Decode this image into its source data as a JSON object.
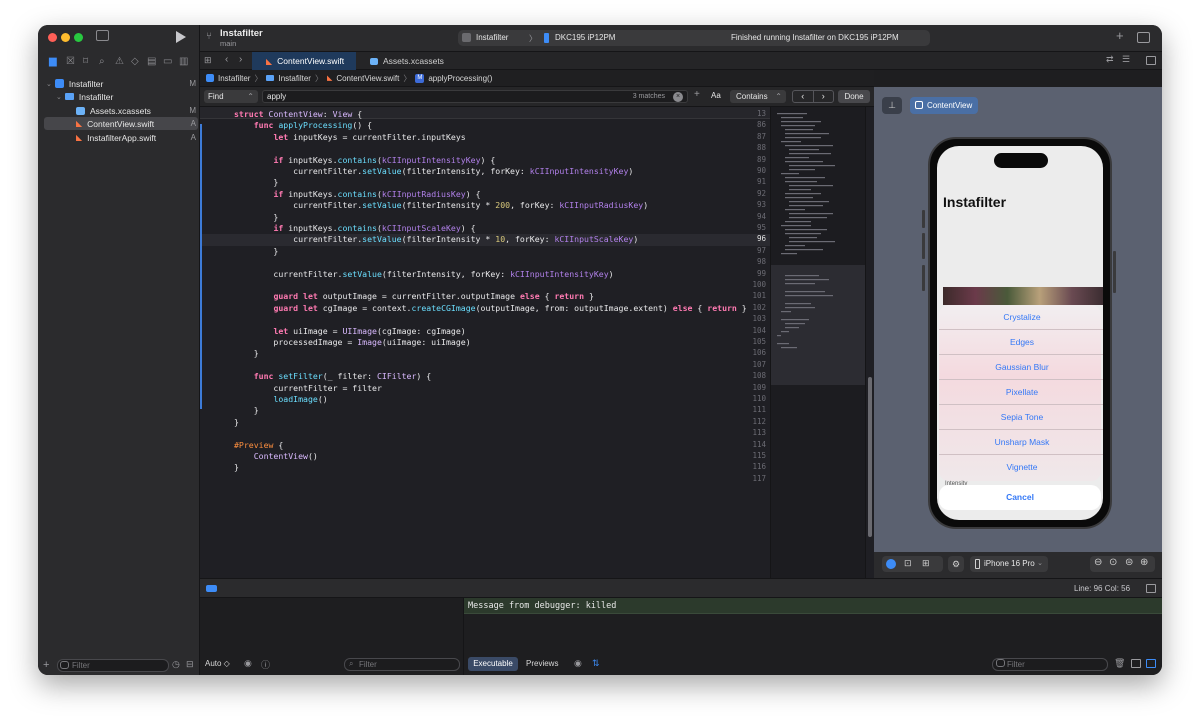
{
  "window": {
    "title": "Instafilter",
    "branch": "main"
  },
  "toolbar": {
    "scheme": "Instafilter",
    "scheme_chevron": "〉",
    "device": "DKC195 iP12PM",
    "status": "Finished running Instafilter on DKC195 iP12PM",
    "add_icon": "+"
  },
  "navigator": {
    "items": [
      {
        "label": "Instafilter",
        "badge": "M"
      },
      {
        "label": "Instafilter",
        "badge": ""
      },
      {
        "label": "Assets.xcassets",
        "badge": "M"
      },
      {
        "label": "ContentView.swift",
        "badge": "A"
      },
      {
        "label": "InstafilterApp.swift",
        "badge": "A"
      }
    ],
    "filter_placeholder": "Filter"
  },
  "tabs": [
    {
      "label": "ContentView.swift",
      "active": true
    },
    {
      "label": "Assets.xcassets",
      "active": false
    }
  ],
  "breadcrumbs": [
    "Instafilter",
    "Instafilter",
    "ContentView.swift",
    "applyProcessing()"
  ],
  "breadcrumb_sep": "〉",
  "find": {
    "mode": "Find",
    "query": "apply",
    "matches": "3 matches",
    "case_label": "Aa",
    "match_type": "Contains",
    "done_label": "Done"
  },
  "code_lines": [
    {
      "n": "13",
      "text": "struct ContentView: View {"
    },
    {
      "n": "86",
      "text": "    func applyProcessing() {"
    },
    {
      "n": "87",
      "text": "        let inputKeys = currentFilter.inputKeys"
    },
    {
      "n": "88",
      "text": ""
    },
    {
      "n": "89",
      "text": "        if inputKeys.contains(kCIInputIntensityKey) {"
    },
    {
      "n": "90",
      "text": "            currentFilter.setValue(filterIntensity, forKey: kCIInputIntensityKey)"
    },
    {
      "n": "91",
      "text": "        }"
    },
    {
      "n": "92",
      "text": "        if inputKeys.contains(kCIInputRadiusKey) {"
    },
    {
      "n": "93",
      "text": "            currentFilter.setValue(filterIntensity * 200, forKey: kCIInputRadiusKey)"
    },
    {
      "n": "94",
      "text": "        }"
    },
    {
      "n": "95",
      "text": "        if inputKeys.contains(kCIInputScaleKey) {"
    },
    {
      "n": "96",
      "text": "            currentFilter.setValue(filterIntensity * 10, forKey: kCIInputScaleKey)"
    },
    {
      "n": "97",
      "text": "        }"
    },
    {
      "n": "98",
      "text": ""
    },
    {
      "n": "99",
      "text": "        currentFilter.setValue(filterIntensity, forKey: kCIInputIntensityKey)"
    },
    {
      "n": "100",
      "text": ""
    },
    {
      "n": "101",
      "text": "        guard let outputImage = currentFilter.outputImage else { return }"
    },
    {
      "n": "102",
      "text": "        guard let cgImage = context.createCGImage(outputImage, from: outputImage.extent) else { return }"
    },
    {
      "n": "103",
      "text": ""
    },
    {
      "n": "104",
      "text": "        let uiImage = UIImage(cgImage: cgImage)"
    },
    {
      "n": "105",
      "text": "        processedImage = Image(uiImage: uiImage)"
    },
    {
      "n": "106",
      "text": "    }"
    },
    {
      "n": "107",
      "text": ""
    },
    {
      "n": "108",
      "text": "    func setFilter(_ filter: CIFilter) {"
    },
    {
      "n": "109",
      "text": "        currentFilter = filter"
    },
    {
      "n": "110",
      "text": "        loadImage()"
    },
    {
      "n": "111",
      "text": "    }"
    },
    {
      "n": "112",
      "text": "}"
    },
    {
      "n": "113",
      "text": ""
    },
    {
      "n": "114",
      "text": "#Preview {"
    },
    {
      "n": "115",
      "text": "    ContentView()"
    },
    {
      "n": "116",
      "text": "}"
    },
    {
      "n": "117",
      "text": ""
    }
  ],
  "preview": {
    "pin_icon": "pin-icon",
    "chip": "ContentView",
    "app_title": "Instafilter",
    "sheet_items": [
      "Crystalize",
      "Edges",
      "Gaussian Blur",
      "Pixellate",
      "Sepia Tone",
      "Unsharp Mask",
      "Vignette"
    ],
    "cancel_label": "Cancel",
    "hidden_label": "Intensity",
    "device_menu": "iPhone 16 Pro"
  },
  "status": {
    "position": "Line: 96  Col: 56"
  },
  "debug": {
    "auto_label": "Auto ◇",
    "filter_placeholder": "Filter",
    "console_message": "Message from debugger: killed",
    "tab_executable": "Executable",
    "tab_previews": "Previews"
  }
}
